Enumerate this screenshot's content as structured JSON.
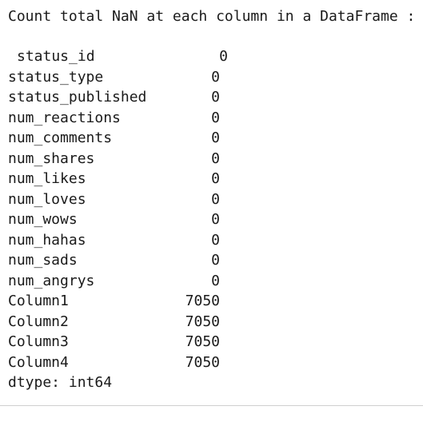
{
  "output": {
    "heading": "Count total NaN at each column in a DataFrame :",
    "rows": [
      {
        "name": "status_id",
        "value": "0"
      },
      {
        "name": "status_type",
        "value": "0"
      },
      {
        "name": "status_published",
        "value": "0"
      },
      {
        "name": "num_reactions",
        "value": "0"
      },
      {
        "name": "num_comments",
        "value": "0"
      },
      {
        "name": "num_shares",
        "value": "0"
      },
      {
        "name": "num_likes",
        "value": "0"
      },
      {
        "name": "num_loves",
        "value": "0"
      },
      {
        "name": "num_wows",
        "value": "0"
      },
      {
        "name": "num_hahas",
        "value": "0"
      },
      {
        "name": "num_sads",
        "value": "0"
      },
      {
        "name": "num_angrys",
        "value": "0"
      },
      {
        "name": "Column1",
        "value": "7050"
      },
      {
        "name": "Column2",
        "value": "7050"
      },
      {
        "name": "Column3",
        "value": "7050"
      },
      {
        "name": "Column4",
        "value": "7050"
      }
    ],
    "dtype": "dtype: int64"
  }
}
